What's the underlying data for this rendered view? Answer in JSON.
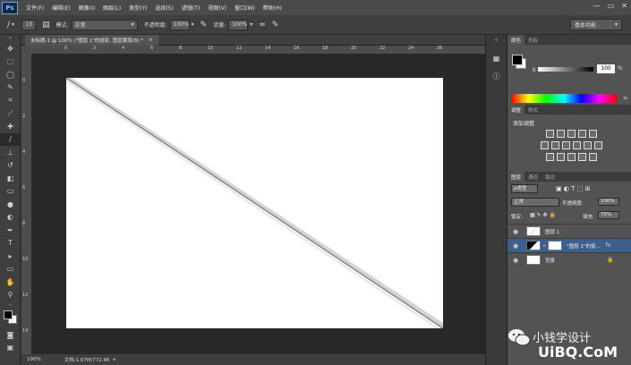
{
  "app": {
    "logo": "Ps"
  },
  "menu": [
    "文件(F)",
    "编辑(E)",
    "图像(I)",
    "图层(L)",
    "类型(Y)",
    "选择(S)",
    "滤镜(T)",
    "视图(V)",
    "窗口(W)",
    "帮助(H)"
  ],
  "window_controls": {
    "minimize": "—",
    "restore": "▭",
    "close": "✕"
  },
  "options": {
    "brush_size": "13",
    "mode_label": "模式:",
    "mode_value": "正常",
    "opacity_label": "不透明度:",
    "opacity_value": "100%",
    "flow_label": "流量:",
    "flow_value": "100%",
    "workspace": "基本功能"
  },
  "document": {
    "tab_title": "未标题-1 @ 100% (\"图层 1\"的投影, 图层蒙版/8) *",
    "ruler_h": [
      "0",
      "2",
      "4",
      "6",
      "8",
      "10",
      "12",
      "14",
      "16",
      "18",
      "20",
      "22",
      "24",
      "26"
    ],
    "ruler_v": [
      "0",
      "2",
      "4",
      "6",
      "8",
      "10",
      "12",
      "14"
    ],
    "zoom": "100%",
    "doc_size": "文档:1.67M/772.8K"
  },
  "color_panel": {
    "tabs": [
      "颜色",
      "色板"
    ],
    "channel_label": "K",
    "value": "100",
    "unit": "%"
  },
  "adjustments_panel": {
    "tabs": [
      "调整",
      "样式"
    ],
    "title": "添加调整"
  },
  "layers_panel": {
    "tabs": [
      "图层",
      "通道",
      "路径"
    ],
    "filter": "ρ类型",
    "blend_mode": "正常",
    "opacity_label": "不透明度:",
    "opacity_value": "100%",
    "lock_label": "锁定:",
    "fill_label": "填充:",
    "fill_value": "75%",
    "layers": [
      {
        "name": "图层 1",
        "selected": false
      },
      {
        "name": "\"图层 1\"的投...",
        "selected": true
      },
      {
        "name": "背景",
        "selected": false
      }
    ]
  },
  "watermark": {
    "name": "小钱学设计",
    "url": "UiBQ.CoM"
  },
  "colors": {
    "accent_selected": "#3d5f8e",
    "canvas": "#ffffff",
    "ui_dark": "#282828"
  }
}
